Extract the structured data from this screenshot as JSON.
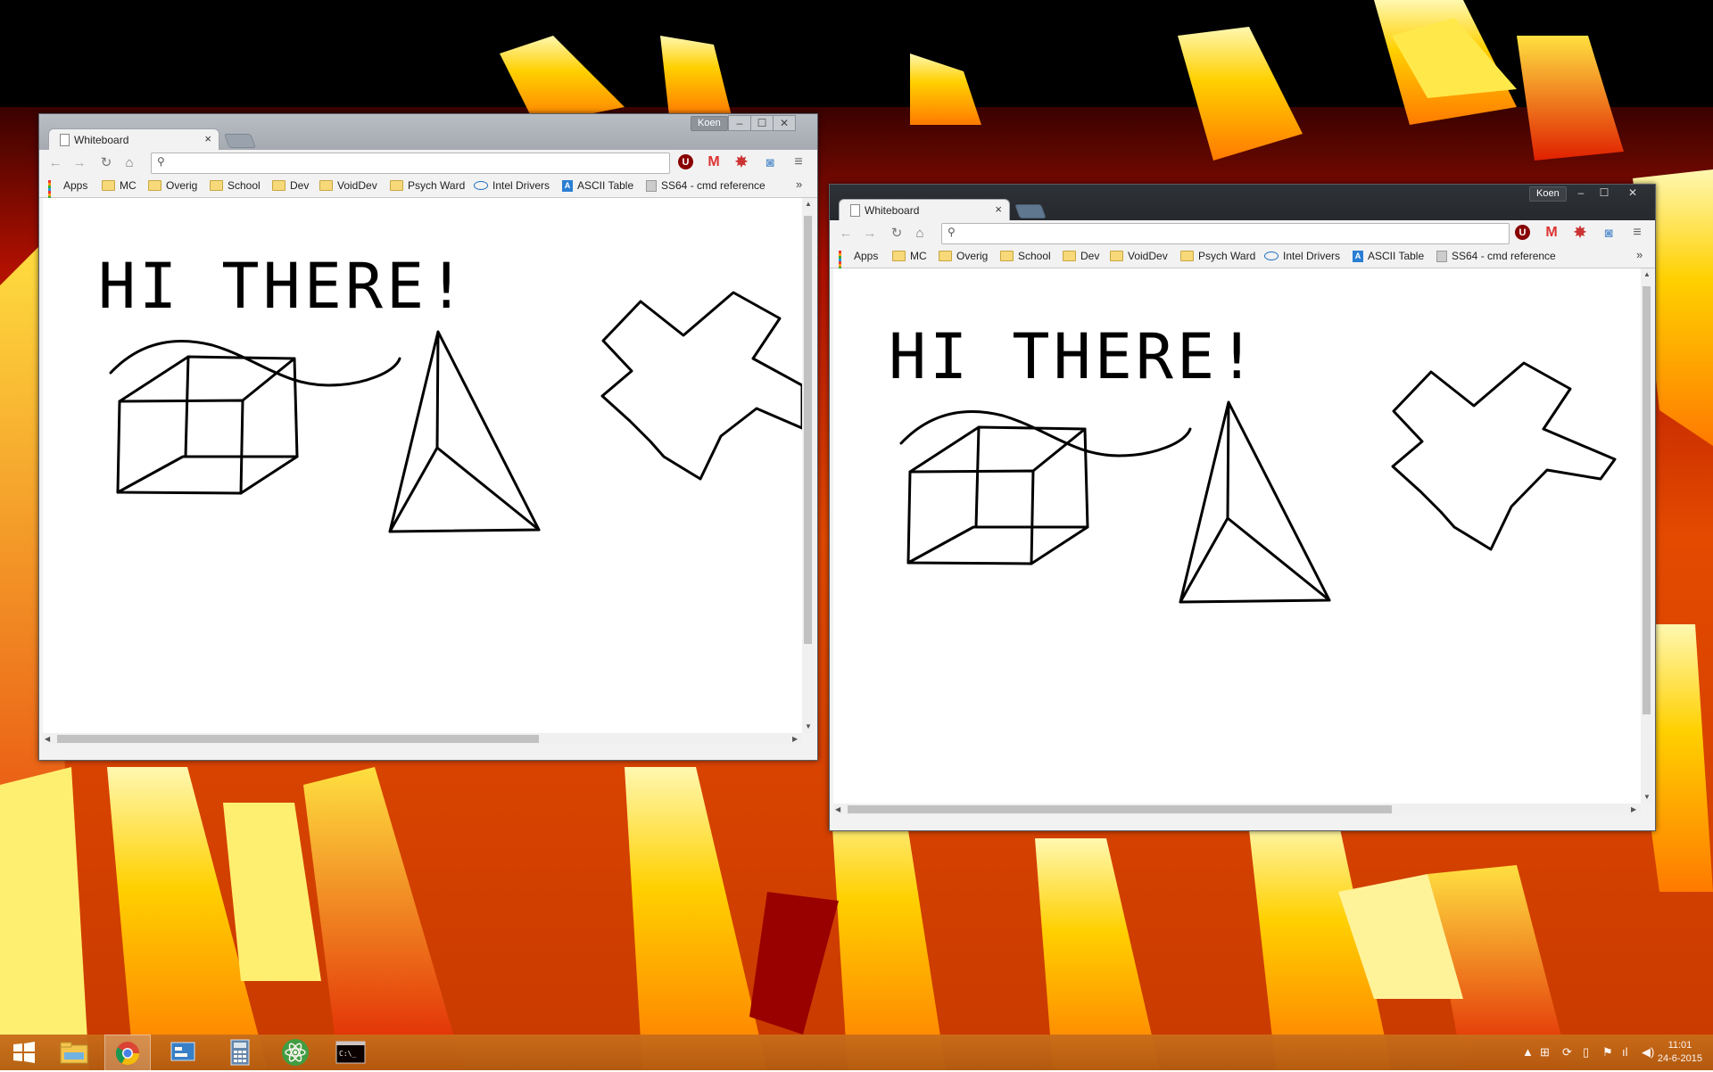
{
  "desktop": {
    "wallpaper": "fire abstract wallpaper"
  },
  "windows": [
    {
      "id": "window-left",
      "user": "Koen",
      "tab_title": "Whiteboard",
      "omnibox_value": "",
      "theme": "light"
    },
    {
      "id": "window-right",
      "user": "Koen",
      "tab_title": "Whiteboard",
      "omnibox_value": "",
      "theme": "dark"
    }
  ],
  "bookmarks": [
    {
      "label": "Apps",
      "icon": "apps-grid-icon"
    },
    {
      "label": "MC",
      "icon": "folder-icon"
    },
    {
      "label": "Overig",
      "icon": "folder-icon"
    },
    {
      "label": "School",
      "icon": "folder-icon"
    },
    {
      "label": "Dev",
      "icon": "folder-icon"
    },
    {
      "label": "VoidDev",
      "icon": "folder-icon"
    },
    {
      "label": "Psych Ward",
      "icon": "folder-icon"
    },
    {
      "label": "Intel Drivers",
      "icon": "intel-icon"
    },
    {
      "label": "ASCII Table",
      "icon": "ascii-table-icon"
    },
    {
      "label": "SS64 - cmd reference",
      "icon": "document-icon"
    }
  ],
  "whiteboard": {
    "text": "HI THERE!"
  },
  "window_controls": {
    "minimize": "–",
    "maximize": "☐",
    "close": "✕"
  },
  "taskbar": {
    "apps": [
      "start-button",
      "file-explorer",
      "chrome",
      "control-panel",
      "calculator",
      "atom-editor",
      "command-prompt"
    ],
    "clock_time": "11:01",
    "clock_date": "24-6-2015"
  },
  "colors": {
    "taskbar": "#c2661a",
    "ink": "#000000",
    "ublock": "#800000",
    "gmail": "#d33333"
  }
}
